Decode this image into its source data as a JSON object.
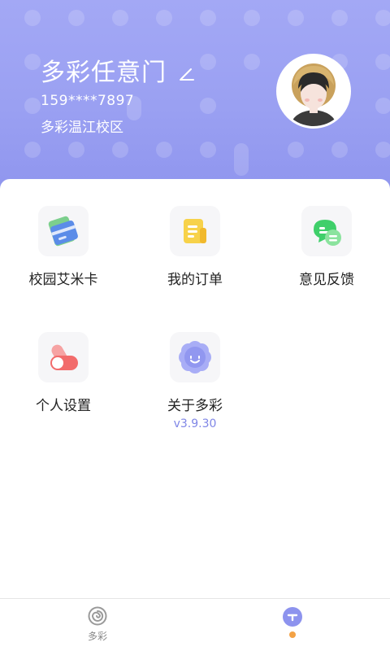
{
  "profile": {
    "username": "多彩任意门",
    "phone": "159****7897",
    "campus": "多彩温江校区"
  },
  "menu": {
    "row1": [
      {
        "label": "校园艾米卡",
        "icon": "card-icon"
      },
      {
        "label": "我的订单",
        "icon": "order-icon"
      },
      {
        "label": "意见反馈",
        "icon": "feedback-icon"
      }
    ],
    "row2": [
      {
        "label": "个人设置",
        "icon": "toggle-settings-icon"
      },
      {
        "label": "关于多彩",
        "icon": "flower-smile-icon",
        "version": "v3.9.30"
      }
    ]
  },
  "tabbar": {
    "tabs": [
      {
        "label": "多彩",
        "icon": "spiral-icon",
        "active": false
      },
      {
        "label": "",
        "icon": "profile-tab-icon",
        "active": true
      }
    ]
  },
  "colors": {
    "header_bg": "#9aa0f2",
    "accent": "#7f86e6",
    "active_dot": "#f3a245"
  }
}
